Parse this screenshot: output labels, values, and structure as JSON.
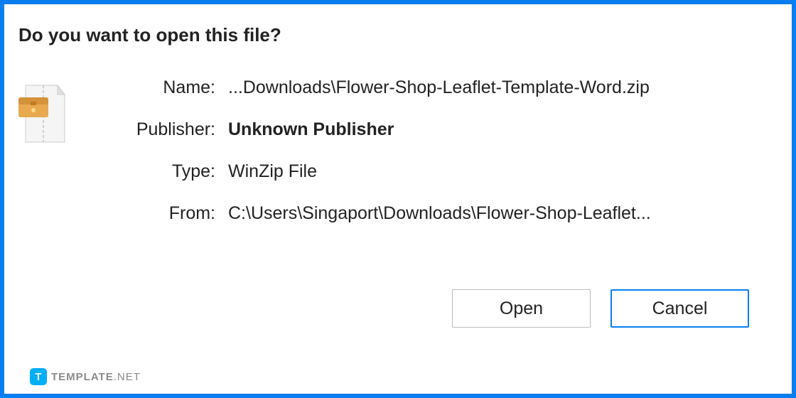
{
  "dialog": {
    "title": "Do you want to open this file?",
    "fields": {
      "name_label": "Name:",
      "name_value": "...Downloads\\Flower-Shop-Leaflet-Template-Word.zip",
      "publisher_label": "Publisher:",
      "publisher_value": "Unknown Publisher",
      "type_label": "Type:",
      "type_value": "WinZip File",
      "from_label": "From:",
      "from_value": "C:\\Users\\Singaport\\Downloads\\Flower-Shop-Leaflet..."
    },
    "buttons": {
      "open": "Open",
      "cancel": "Cancel"
    }
  },
  "watermark": {
    "logo_letter": "T",
    "brand": "TEMPLATE",
    "suffix": ".NET"
  }
}
